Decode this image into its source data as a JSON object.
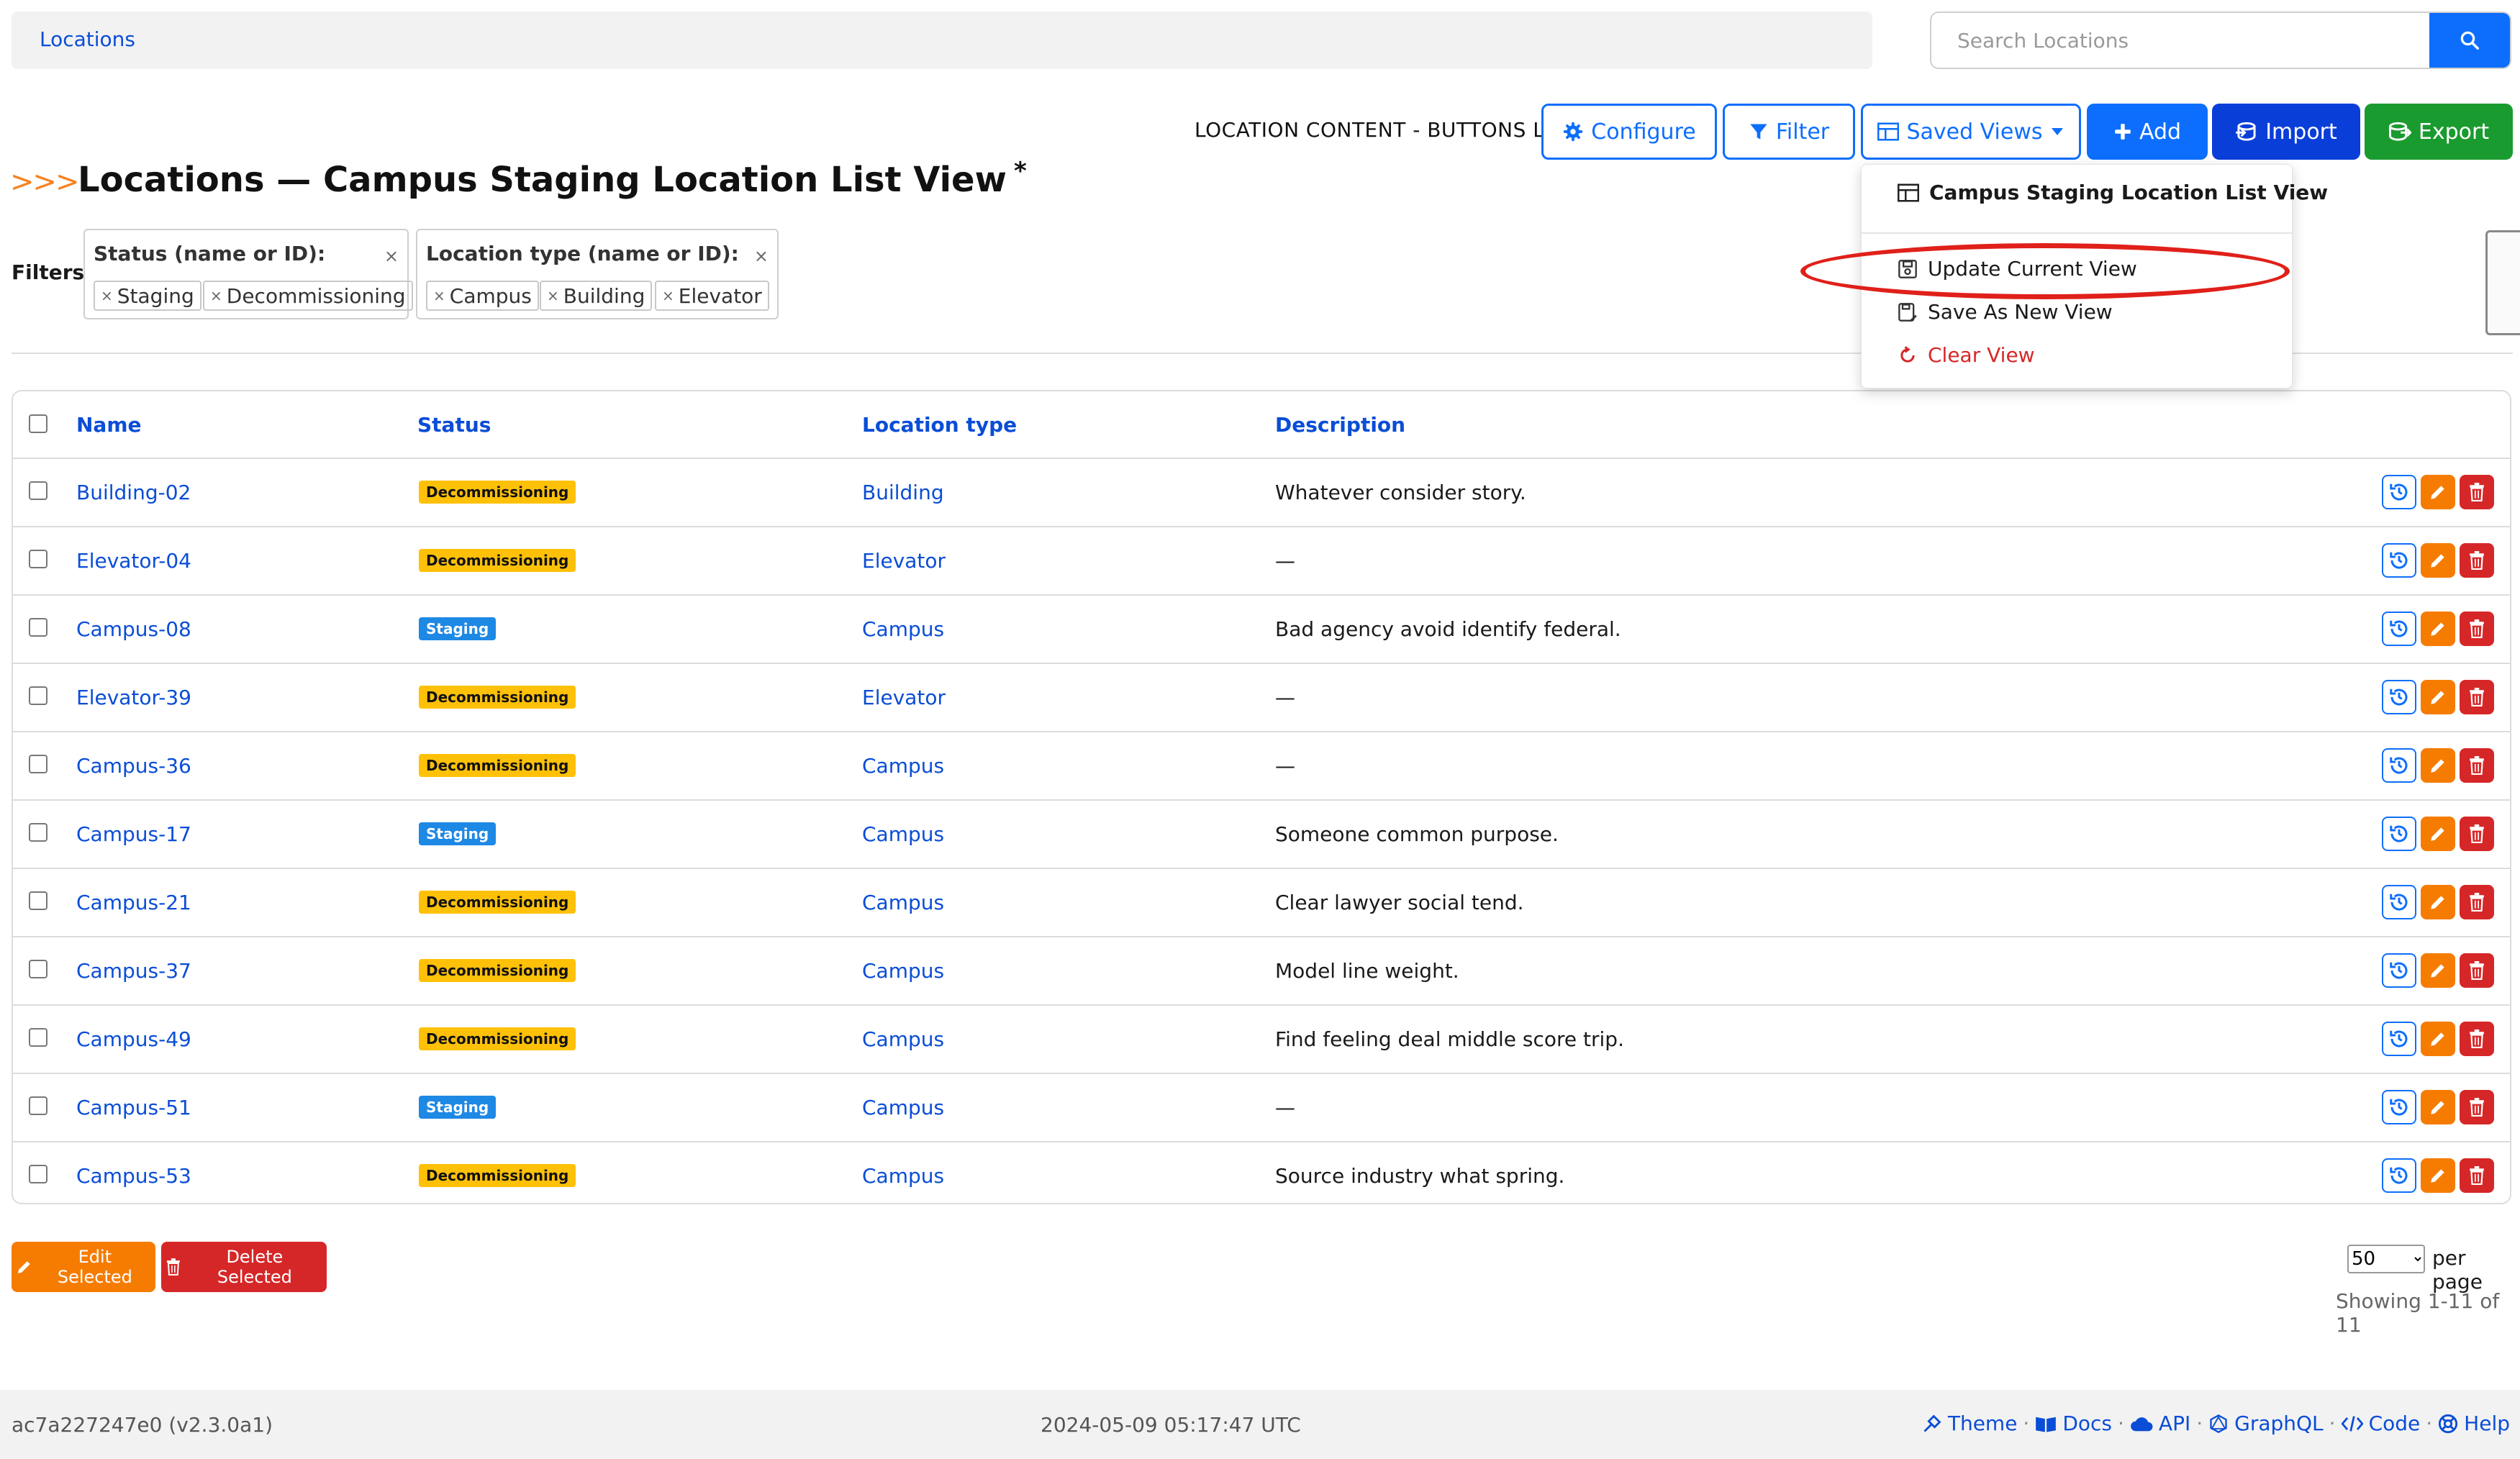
{
  "breadcrumb": {
    "label": "Locations"
  },
  "search": {
    "placeholder": "Search Locations"
  },
  "toolbar": {
    "label": "LOCATION CONTENT - BUTTONS LIST",
    "configure": "Configure",
    "filter": "Filter",
    "saved_views": "Saved Views",
    "add": "Add",
    "import": "Import",
    "export": "Export"
  },
  "page": {
    "title": "Locations — Campus Staging Location List View",
    "title_marker": "*"
  },
  "filters": {
    "label": "Filters:",
    "groups": [
      {
        "title": "Status (name or ID):",
        "values": [
          "Staging",
          "Decommissioning"
        ]
      },
      {
        "title": "Location type (name or ID):",
        "values": [
          "Campus",
          "Building",
          "Elevator"
        ]
      }
    ]
  },
  "saved_views_menu": {
    "current": "Campus Staging Location List View",
    "items": [
      "Update Current View",
      "Save As New View",
      "Clear View"
    ]
  },
  "table": {
    "columns": [
      "Name",
      "Status",
      "Location type",
      "Description"
    ],
    "rows": [
      {
        "name": "Building-02",
        "status": "Decommissioning",
        "type": "Building",
        "description": "Whatever consider story."
      },
      {
        "name": "Elevator-04",
        "status": "Decommissioning",
        "type": "Elevator",
        "description": "—"
      },
      {
        "name": "Campus-08",
        "status": "Staging",
        "type": "Campus",
        "description": "Bad agency avoid identify federal."
      },
      {
        "name": "Elevator-39",
        "status": "Decommissioning",
        "type": "Elevator",
        "description": "—"
      },
      {
        "name": "Campus-36",
        "status": "Decommissioning",
        "type": "Campus",
        "description": "—"
      },
      {
        "name": "Campus-17",
        "status": "Staging",
        "type": "Campus",
        "description": "Someone common purpose."
      },
      {
        "name": "Campus-21",
        "status": "Decommissioning",
        "type": "Campus",
        "description": "Clear lawyer social tend."
      },
      {
        "name": "Campus-37",
        "status": "Decommissioning",
        "type": "Campus",
        "description": "Model line weight."
      },
      {
        "name": "Campus-49",
        "status": "Decommissioning",
        "type": "Campus",
        "description": "Find feeling deal middle score trip."
      },
      {
        "name": "Campus-51",
        "status": "Staging",
        "type": "Campus",
        "description": "—"
      },
      {
        "name": "Campus-53",
        "status": "Decommissioning",
        "type": "Campus",
        "description": "Source industry what spring."
      }
    ]
  },
  "bulk": {
    "edit": "Edit Selected",
    "delete": "Delete Selected"
  },
  "pagination": {
    "per_page": "50",
    "per_page_label": "per page",
    "showing": "Showing 1-11 of 11"
  },
  "footer": {
    "version": "ac7a227247e0 (v2.3.0a1)",
    "timestamp": "2024-05-09 05:17:47 UTC",
    "links": [
      "Theme",
      "Docs",
      "API",
      "GraphQL",
      "Code",
      "Help"
    ]
  },
  "colors": {
    "primary": "#0d6efd",
    "link": "#0a4dd6",
    "import": "#0a3ed9",
    "export": "#1a9b2f",
    "decommissioning": "#ffc107",
    "staging": "#1e88e5",
    "edit": "#f57c00",
    "delete": "#d62728",
    "highlight": "#e0201a",
    "accent": "#f58220"
  },
  "icons": [
    "search-icon",
    "gear-icon",
    "filter-icon",
    "table-icon",
    "caret-down-icon",
    "plus-icon",
    "import-icon",
    "export-icon",
    "history-icon",
    "pencil-icon",
    "trash-icon",
    "save-icon",
    "save-as-icon",
    "clear-icon"
  ]
}
